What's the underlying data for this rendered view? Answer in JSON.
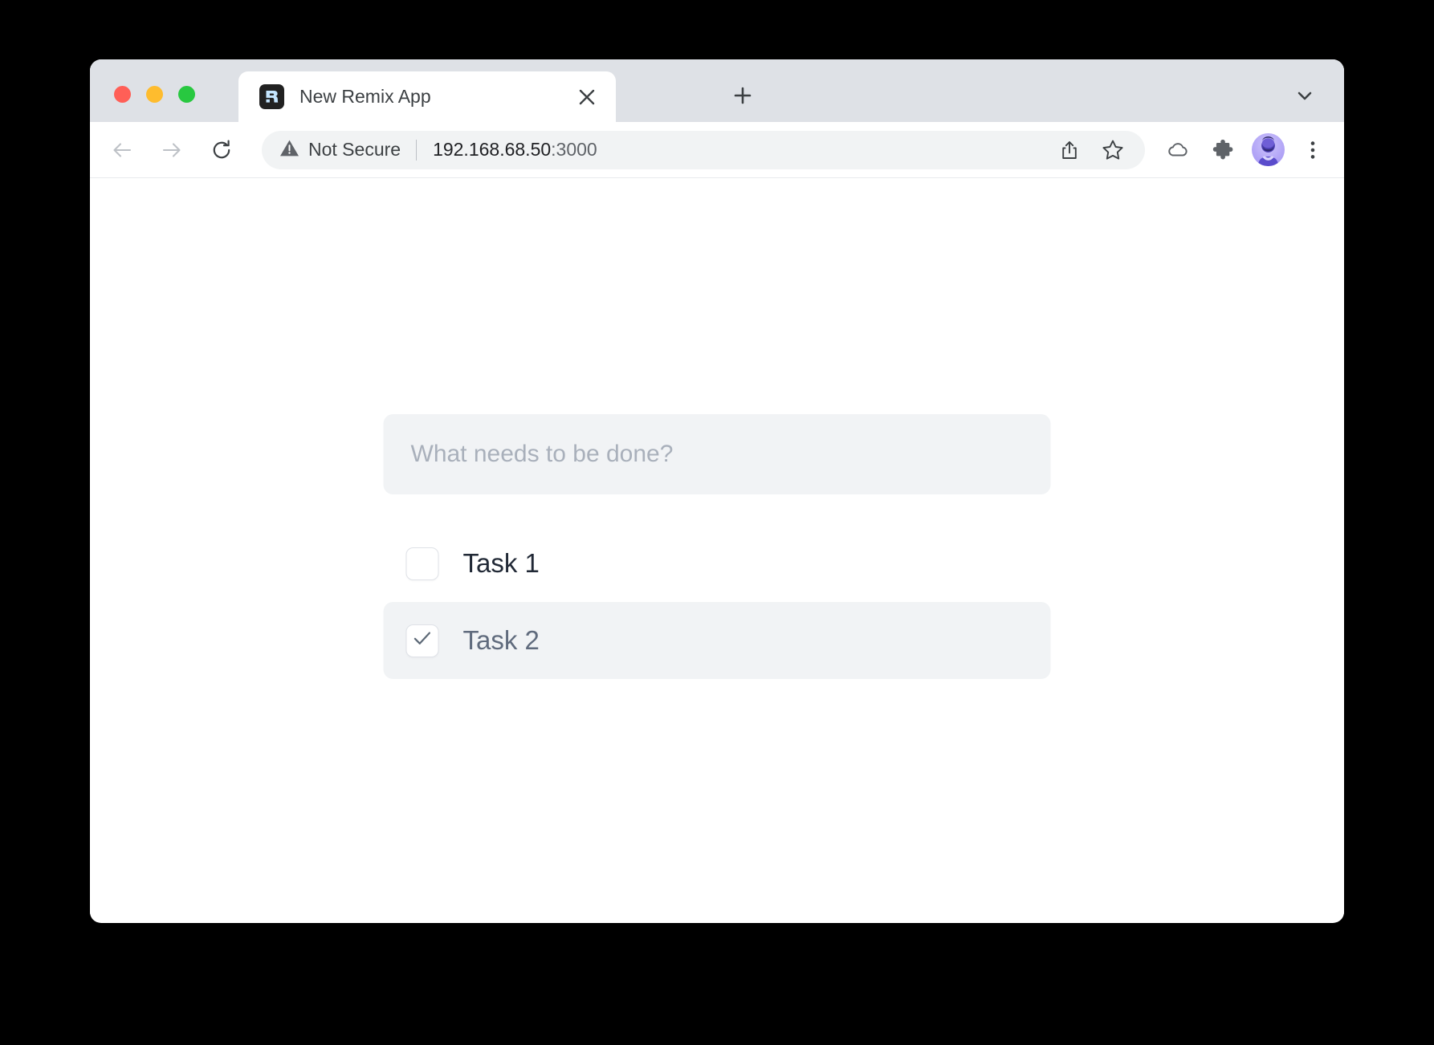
{
  "window": {
    "traffic_lights": [
      {
        "name": "close",
        "color": "#ff5f57"
      },
      {
        "name": "minimize",
        "color": "#febc2e"
      },
      {
        "name": "zoom",
        "color": "#28c840"
      }
    ]
  },
  "tabstrip": {
    "background": "#dee1e6",
    "tabs": [
      {
        "title": "New Remix App",
        "favicon": "remix-logo-icon",
        "active": true,
        "close_icon": "close-icon"
      }
    ],
    "new_tab_icon": "plus-icon",
    "tab_search_icon": "chevron-down-icon"
  },
  "toolbar": {
    "back_icon": "arrow-left-icon",
    "forward_icon": "arrow-right-icon",
    "reload_icon": "reload-icon",
    "omnibox": {
      "security_icon": "warning-triangle-icon",
      "security_label": "Not Secure",
      "url_host": "192.168.68.50",
      "url_port": ":3000",
      "background": "#f1f3f4",
      "actions": [
        {
          "name": "share-icon",
          "label": "Share"
        },
        {
          "name": "star-icon",
          "label": "Bookmark"
        }
      ]
    },
    "actions": [
      {
        "name": "cloud-icon",
        "label": "Cloud"
      },
      {
        "name": "puzzle-icon",
        "label": "Extensions"
      },
      {
        "name": "avatar",
        "label": "Profile"
      },
      {
        "name": "more-vertical-icon",
        "label": "Customize and control"
      }
    ]
  },
  "page": {
    "background": "#ffffff",
    "todo": {
      "input": {
        "placeholder": "What needs to be done?",
        "value": "",
        "background": "#f1f3f5"
      },
      "items": [
        {
          "label": "Task 1",
          "checked": false
        },
        {
          "label": "Task 2",
          "checked": true
        }
      ],
      "checked_row_background": "#f1f3f5",
      "check_icon": "check-icon"
    }
  }
}
